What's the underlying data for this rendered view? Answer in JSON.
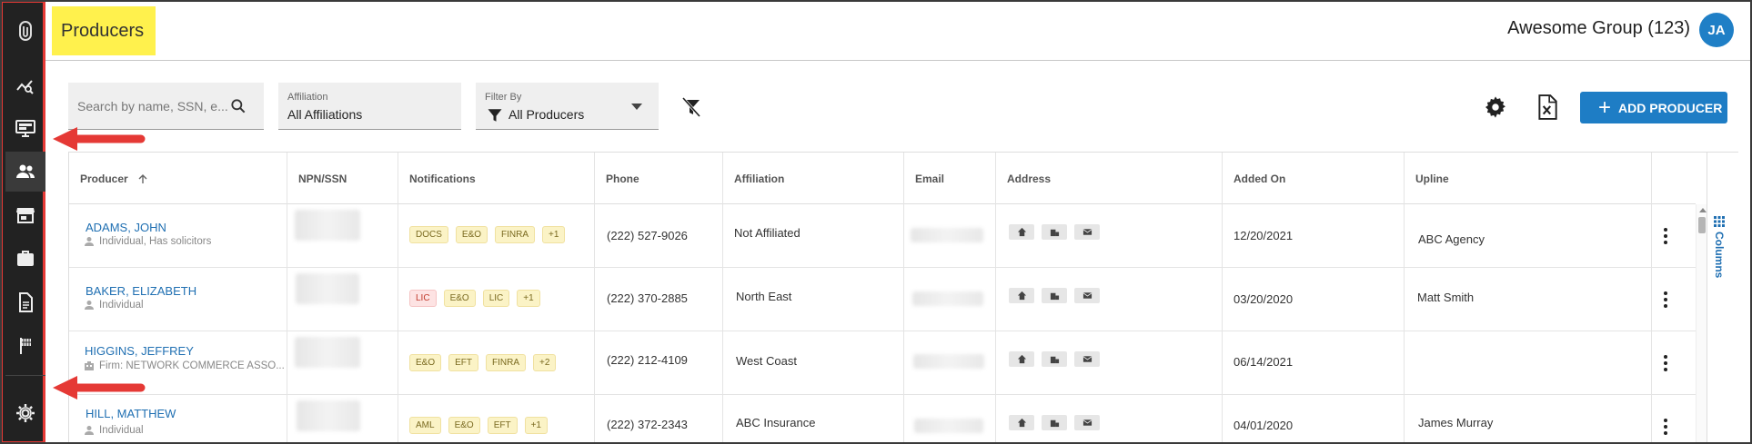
{
  "header": {
    "title": "Producers",
    "group_name": "Awesome Group (123)",
    "avatar_initials": "JA"
  },
  "sidebar": {
    "items": [
      {
        "icon": "logo-icon",
        "active": false
      },
      {
        "icon": "analytics-icon",
        "active": false
      },
      {
        "icon": "monitor-icon",
        "active": false
      },
      {
        "icon": "people-icon",
        "active": true
      },
      {
        "icon": "store-icon",
        "active": false
      },
      {
        "icon": "briefcase-icon",
        "active": false
      },
      {
        "icon": "document-icon",
        "active": false
      },
      {
        "icon": "flag-icon",
        "active": false
      },
      {
        "icon": "gear-icon",
        "active": false
      }
    ]
  },
  "toolbar": {
    "search_placeholder": "Search by name, SSN, e...",
    "affiliation_label": "Affiliation",
    "affiliation_value": "All Affiliations",
    "filter_label": "Filter By",
    "filter_value": "All Producers",
    "add_label": "ADD PRODUCER"
  },
  "table": {
    "columns": [
      "Producer",
      "NPN/SSN",
      "Notifications",
      "Phone",
      "Affiliation",
      "Email",
      "Address",
      "Added On",
      "Upline"
    ],
    "columns_tab": "Columns",
    "rows": [
      {
        "name": "ADAMS, JOHN",
        "subtitle": "Individual, Has solicitors",
        "subtitle_icon": "person-icon",
        "badges": [
          {
            "t": "DOCS",
            "c": "yellow"
          },
          {
            "t": "E&O",
            "c": "yellow"
          },
          {
            "t": "FINRA",
            "c": "yellow"
          },
          {
            "t": "+1",
            "c": "yellow"
          }
        ],
        "phone": "(222) 527-9026",
        "affiliation": "Not Affiliated",
        "added_on": "12/20/2021",
        "upline": "ABC Agency"
      },
      {
        "name": "BAKER, ELIZABETH",
        "subtitle": "Individual",
        "subtitle_icon": "person-icon",
        "badges": [
          {
            "t": "LIC",
            "c": "red"
          },
          {
            "t": "E&O",
            "c": "yellow"
          },
          {
            "t": "LIC",
            "c": "yellow"
          },
          {
            "t": "+1",
            "c": "yellow"
          }
        ],
        "phone": "(222) 370-2885",
        "affiliation": "North East",
        "added_on": "03/20/2020",
        "upline": "Matt Smith"
      },
      {
        "name": "HIGGINS, JEFFREY",
        "subtitle": "Firm: NETWORK COMMERCE ASSO...",
        "subtitle_icon": "building-icon",
        "badges": [
          {
            "t": "E&O",
            "c": "yellow"
          },
          {
            "t": "EFT",
            "c": "yellow"
          },
          {
            "t": "FINRA",
            "c": "yellow"
          },
          {
            "t": "+2",
            "c": "yellow"
          }
        ],
        "phone": "(222) 212-4109",
        "affiliation": "West Coast",
        "added_on": "06/14/2021",
        "upline": ""
      },
      {
        "name": "HILL, MATTHEW",
        "subtitle": "Individual",
        "subtitle_icon": "person-icon",
        "badges": [
          {
            "t": "AML",
            "c": "yellow"
          },
          {
            "t": "E&O",
            "c": "yellow"
          },
          {
            "t": "EFT",
            "c": "yellow"
          },
          {
            "t": "+1",
            "c": "yellow"
          }
        ],
        "phone": "(222) 372-2343",
        "affiliation": "ABC Insurance",
        "added_on": "04/01/2020",
        "upline": "James Murray"
      }
    ]
  },
  "colors": {
    "accent": "#1e7dc5",
    "title_highlight": "#fff14d",
    "sidebar_bg": "#222222",
    "annotation_red": "#e53935"
  }
}
